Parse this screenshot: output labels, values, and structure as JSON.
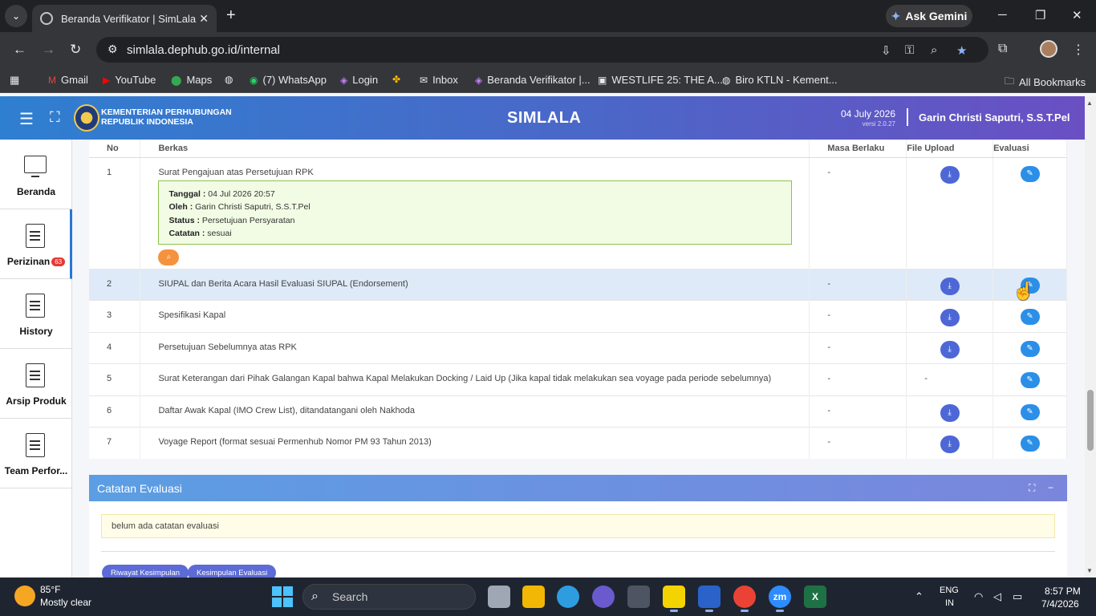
{
  "browser": {
    "tab_title": "Beranda Verifikator | SimLala",
    "new_tab_symbol": "+",
    "gemini_label": "Ask Gemini",
    "url": "simlala.dephub.go.id/internal",
    "bookmarks": [
      {
        "icon": "gmail-icon",
        "label": "Gmail"
      },
      {
        "icon": "youtube-icon",
        "label": "YouTube"
      },
      {
        "icon": "maps-icon",
        "label": "Maps"
      },
      {
        "icon": "globe-icon",
        "label": ""
      },
      {
        "icon": "whatsapp-icon",
        "label": "(7) WhatsApp"
      },
      {
        "icon": "login-icon",
        "label": "Login"
      },
      {
        "icon": "pinwheel-icon",
        "label": ""
      },
      {
        "icon": "inbox-icon",
        "label": "Inbox"
      },
      {
        "icon": "simlala-icon",
        "label": "Beranda Verifikator |..."
      },
      {
        "icon": "bookmark-icon",
        "label": "WESTLIFE 25: THE A..."
      },
      {
        "icon": "globe-icon",
        "label": "Biro KTLN - Kement..."
      }
    ],
    "all_bookmarks": "All Bookmarks"
  },
  "header": {
    "org_line1": "KEMENTERIAN PERHUBUNGAN",
    "org_line2": "REPUBLIK INDONESIA",
    "app_title": "SIMLALA",
    "date": "04 July 2026",
    "version": "versi 2.0.27",
    "user": "Garin Christi Saputri, S.S.T.Pel"
  },
  "sidebar": {
    "items": [
      {
        "label": "Beranda",
        "icon": "monitor-icon"
      },
      {
        "label": "Perizinan",
        "badge": "63",
        "icon": "document-icon"
      },
      {
        "label": "History",
        "icon": "document-icon"
      },
      {
        "label": "Arsip Produk",
        "icon": "document-icon"
      },
      {
        "label": "Team Perfor...",
        "icon": "document-icon"
      }
    ]
  },
  "table": {
    "headers": {
      "no": "No",
      "berkas": "Berkas",
      "masa": "Masa Berlaku",
      "file": "File Upload",
      "eval": "Evaluasi"
    },
    "rows": [
      {
        "no": "1",
        "berkas": "Surat Pengajuan atas Persetujuan RPK",
        "masa": "-",
        "file": "download-icon",
        "eval": "edit-icon"
      },
      {
        "no": "2",
        "berkas": "SIUPAL dan Berita Acara Hasil Evaluasi SIUPAL (Endorsement)",
        "masa": "-",
        "file": "download-icon",
        "eval": "edit-icon"
      },
      {
        "no": "3",
        "berkas": "Spesifikasi Kapal",
        "masa": "-",
        "file": "download-icon",
        "eval": "edit-icon"
      },
      {
        "no": "4",
        "berkas": "Persetujuan Sebelumnya atas RPK",
        "masa": "-",
        "file": "download-icon",
        "eval": "edit-icon"
      },
      {
        "no": "5",
        "berkas": "Surat Keterangan dari Pihak Galangan Kapal bahwa Kapal Melakukan Docking / Laid Up (Jika kapal tidak melakukan sea voyage pada periode sebelumnya)",
        "masa": "-",
        "file": "-",
        "eval": "edit-icon"
      },
      {
        "no": "6",
        "berkas": "Daftar Awak Kapal (IMO Crew List), ditandatangani oleh Nakhoda",
        "masa": "-",
        "file": "download-icon",
        "eval": "edit-icon"
      },
      {
        "no": "7",
        "berkas": "Voyage Report (format sesuai Permenhub Nomor PM 93 Tahun 2013)",
        "masa": "-",
        "file": "download-icon",
        "eval": "edit-icon"
      }
    ],
    "detail": {
      "tanggal_label": "Tanggal :",
      "tanggal": "04 Jul 2026 20:57",
      "oleh_label": "Oleh :",
      "oleh": "Garin Christi Saputri, S.S.T.Pel",
      "status_label": "Status :",
      "status": "Persetujuan Persyaratan",
      "catatan_label": "Catatan :",
      "catatan": "sesuai"
    }
  },
  "catatan": {
    "title": "Catatan Evaluasi",
    "note": "belum ada catatan evaluasi",
    "btn_riwayat": "Riwayat Kesimpulan",
    "btn_kesimpulan": "Kesimpulan Evaluasi"
  },
  "taskbar": {
    "temp": "85°F",
    "weather": "Mostly clear",
    "search": "Search",
    "lang1": "ENG",
    "lang2": "IN",
    "time": "8:57 PM",
    "date": "7/4/2026"
  }
}
